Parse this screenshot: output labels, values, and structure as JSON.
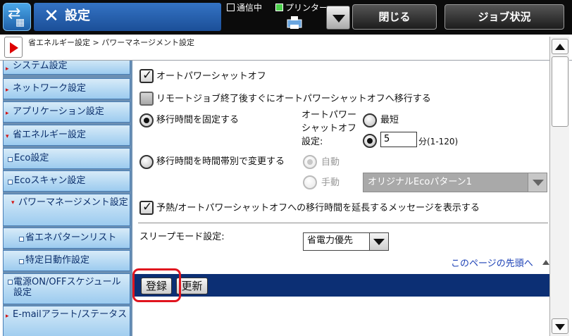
{
  "header": {
    "title": "設定",
    "comm_status": "通信中",
    "printer_status": "プリンター",
    "close_label": "閉じる",
    "job_status_label": "ジョブ状況"
  },
  "breadcrumb": "省エネルギー設定 > パワーマネージメント設定",
  "sidebar": {
    "items": [
      {
        "label": "システム設定"
      },
      {
        "label": "ネットワーク設定"
      },
      {
        "label": "アプリケーション設定"
      },
      {
        "label": "省エネルギー設定"
      },
      {
        "label": "Eco設定"
      },
      {
        "label": "Ecoスキャン設定"
      },
      {
        "label": "パワーマネージメント設定"
      },
      {
        "label": "省エネパターンリスト"
      },
      {
        "label": "特定日動作設定"
      },
      {
        "label": "電源ON/OFFスケジュール設定"
      },
      {
        "label": "E-mailアラート/ステータス"
      }
    ]
  },
  "main": {
    "auto_power_off": {
      "label": "オートパワーシャットオフ",
      "checked": true
    },
    "remote_job_power_off": {
      "label": "リモートジョブ終了後すぐにオートパワーシャットオフへ移行する",
      "checked": false
    },
    "fixed_time": {
      "label": "移行時間を固定する",
      "selected": true
    },
    "auto_power_off_setting_label": "オートパワーシャットオフ設定:",
    "shortest": {
      "label": "最短"
    },
    "minutes": {
      "value": "5",
      "unit": "分(1-120)"
    },
    "time_zone_change": {
      "label": "移行時間を時間帯別で変更する",
      "selected": false
    },
    "automatic": {
      "label": "自動"
    },
    "manual": {
      "label": "手動"
    },
    "pattern_select": {
      "value": "オリジナルEcoパターン1"
    },
    "extend_message": {
      "label": "予熱/オートパワーシャットオフへの移行時間を延長するメッセージを表示する",
      "checked": true
    },
    "sleep_mode": {
      "label": "スリープモード設定:",
      "value": "省電力優先"
    },
    "back_to_top": "このページの先頭へ",
    "register_label": "登録",
    "update_label": "更新"
  },
  "colors": {
    "title_bar": "#1b4f98",
    "sidebar_item": "#9ccbef",
    "action_bar": "#0c2f74",
    "highlight": "#e0141e",
    "link": "#1a3fb5"
  }
}
